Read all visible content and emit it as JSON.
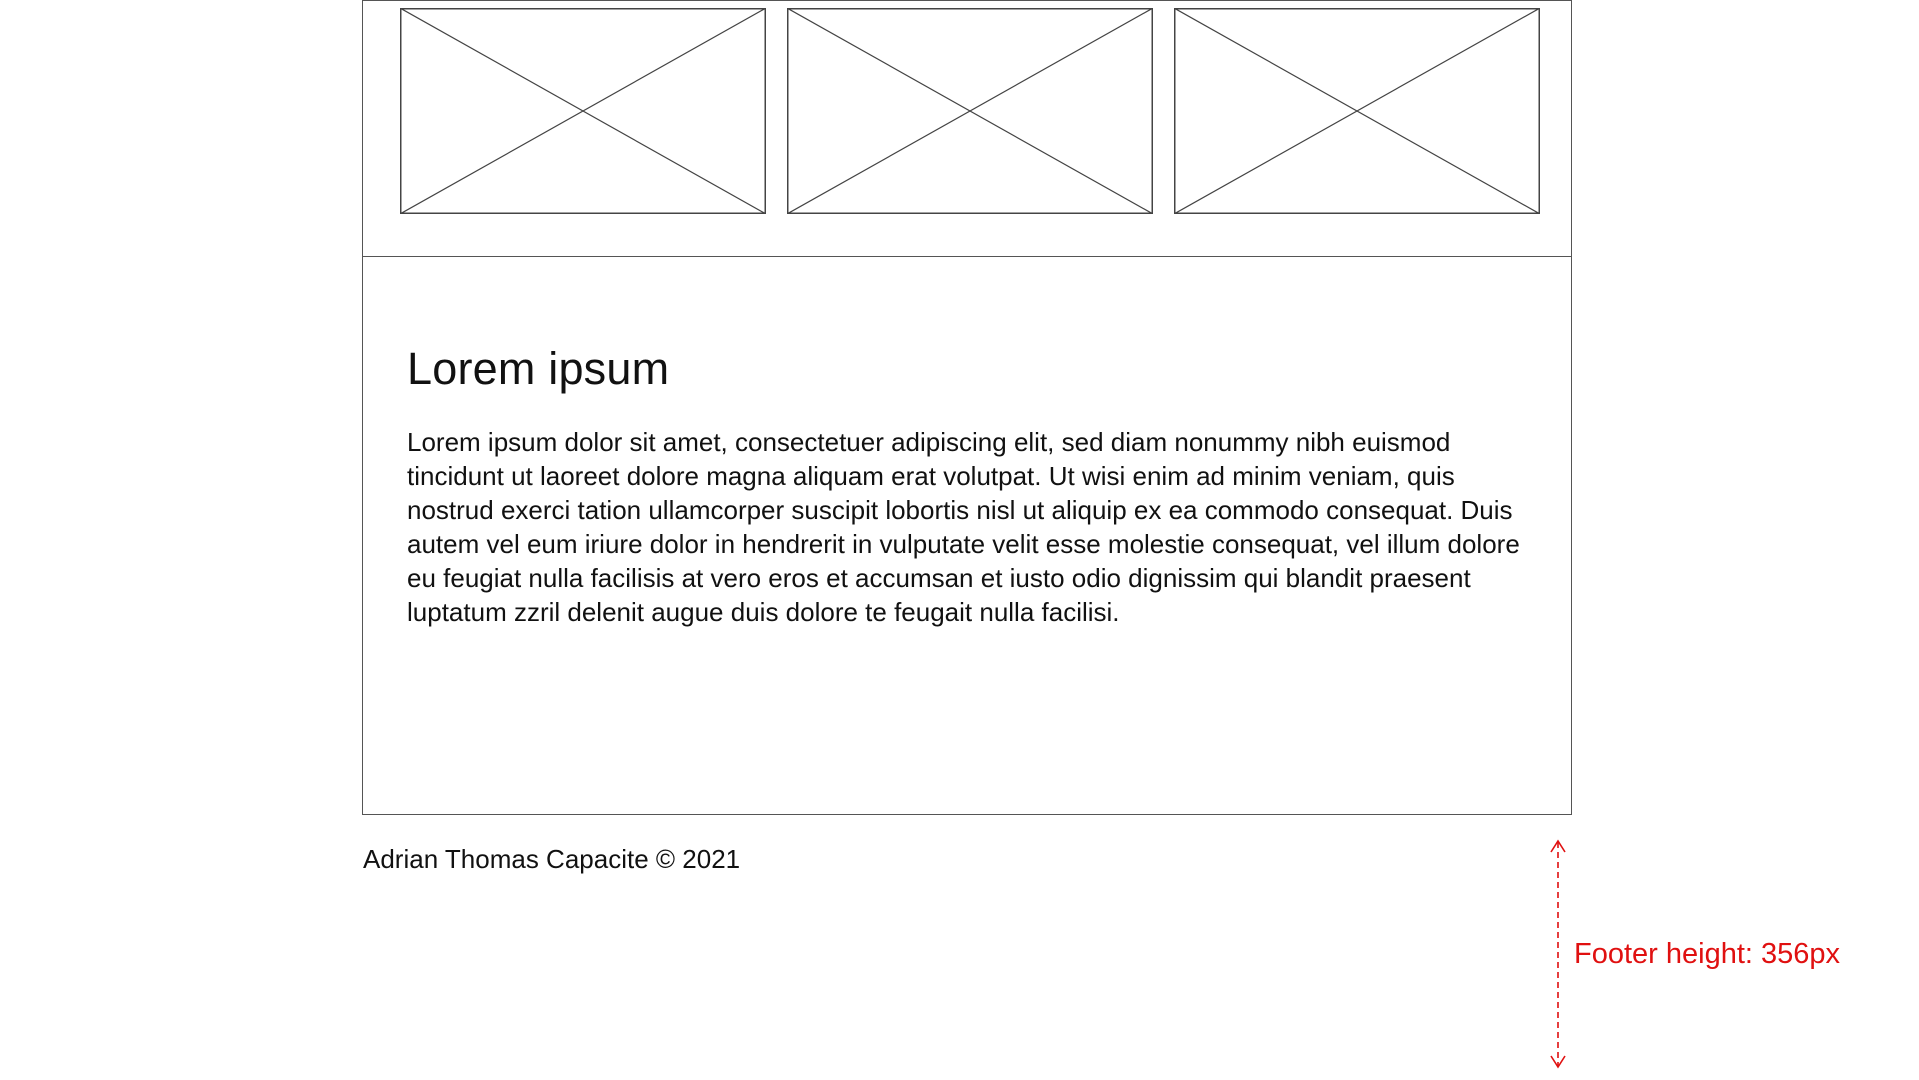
{
  "content": {
    "title": "Lorem ipsum",
    "body": "Lorem ipsum dolor sit amet, consectetuer adipiscing elit, sed diam nonummy nibh euismod tincidunt ut laoreet dolore magna aliquam erat volutpat. Ut wisi enim ad minim veniam, quis nostrud exerci tation ullamcorper suscipit lobortis nisl ut aliquip ex ea commodo consequat. Duis autem vel eum iriure dolor in hendrerit in vulputate velit esse molestie consequat, vel illum dolore eu feugiat nulla facilisis at vero eros et accumsan et iusto odio dignissim qui blandit praesent luptatum zzril delenit augue duis dolore te feugait nulla facilisi."
  },
  "footer": {
    "credit": "Adrian Thomas Capacite © 2021"
  },
  "annotation": {
    "label": "Footer height: 356px",
    "color": "#e01010"
  },
  "gallery": {
    "placeholders": [
      "image-placeholder-icon",
      "image-placeholder-icon",
      "image-placeholder-icon"
    ]
  }
}
